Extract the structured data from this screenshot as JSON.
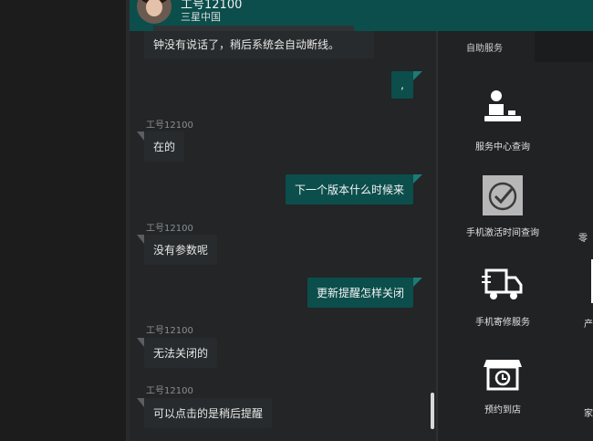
{
  "header": {
    "agent_title": "工号12100",
    "company": "三星中国"
  },
  "chat": {
    "top_message": "钟没有说话了，稍后系统会自动断线。",
    "messages": [
      {
        "side": "out",
        "text": ","
      },
      {
        "side": "label",
        "text": "工号12100"
      },
      {
        "side": "in",
        "text": "在的"
      },
      {
        "side": "out",
        "text": "下一个版本什么时候来"
      },
      {
        "side": "label",
        "text": "工号12100"
      },
      {
        "side": "in",
        "text": "没有参数呢"
      },
      {
        "side": "out",
        "text": "更新提醒怎样关闭"
      },
      {
        "side": "label",
        "text": "工号12100"
      },
      {
        "side": "in",
        "text": "无法关闭的"
      },
      {
        "side": "label",
        "text": "工号12100"
      },
      {
        "side": "in",
        "text": "可以点击的是稍后提醒"
      }
    ]
  },
  "panel": {
    "section_title": "自助服务",
    "services": [
      {
        "label": "服务中心查询",
        "icon": "service-desk-icon"
      },
      {
        "label": "手机激活时间查询",
        "icon": "activation-clock-icon"
      },
      {
        "label": "手机寄修服务",
        "icon": "delivery-truck-icon"
      },
      {
        "label": "预约到店",
        "icon": "store-appointment-icon"
      }
    ],
    "clipped_labels": [
      "零",
      "产",
      "家"
    ]
  },
  "colors": {
    "accent": "#0b4e4c",
    "bubble_in": "#282b2d"
  }
}
